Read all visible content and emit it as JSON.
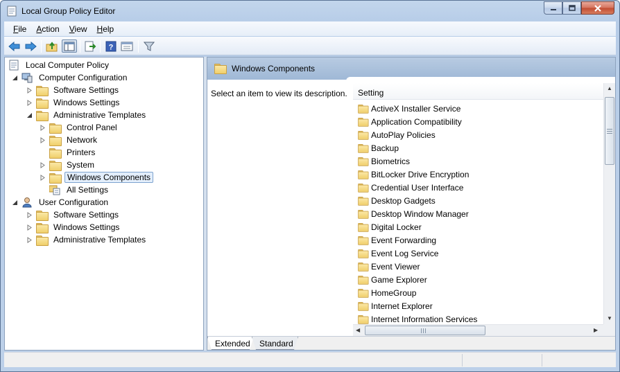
{
  "window": {
    "title": "Local Group Policy Editor"
  },
  "menu": {
    "items": [
      {
        "label": "File",
        "accel": "F",
        "rest": "ile"
      },
      {
        "label": "Action",
        "accel": "A",
        "rest": "ction"
      },
      {
        "label": "View",
        "accel": "V",
        "rest": "iew"
      },
      {
        "label": "Help",
        "accel": "H",
        "rest": "elp"
      }
    ]
  },
  "toolbar": {
    "buttons": [
      "back-icon",
      "forward-icon",
      "up-folder-icon",
      "show-hide-tree-icon",
      "export-list-icon",
      "help-icon",
      "properties-icon",
      "filter-icon"
    ]
  },
  "tree": {
    "root": "Local Computer Policy",
    "computer_configuration": "Computer Configuration",
    "cc_software_settings": "Software Settings",
    "cc_windows_settings": "Windows Settings",
    "cc_admin_templates": "Administrative Templates",
    "control_panel": "Control Panel",
    "network": "Network",
    "printers": "Printers",
    "system": "System",
    "windows_components": "Windows Components",
    "all_settings": "All Settings",
    "user_configuration": "User Configuration",
    "uc_software_settings": "Software Settings",
    "uc_windows_settings": "Windows Settings",
    "uc_admin_templates": "Administrative Templates"
  },
  "details": {
    "header_title": "Windows Components",
    "description": "Select an item to view its description.",
    "column_setting": "Setting",
    "items": [
      "ActiveX Installer Service",
      "Application Compatibility",
      "AutoPlay Policies",
      "Backup",
      "Biometrics",
      "BitLocker Drive Encryption",
      "Credential User Interface",
      "Desktop Gadgets",
      "Desktop Window Manager",
      "Digital Locker",
      "Event Forwarding",
      "Event Log Service",
      "Event Viewer",
      "Game Explorer",
      "HomeGroup",
      "Internet Explorer",
      "Internet Information Services"
    ]
  },
  "tabs": {
    "extended": "Extended",
    "standard": "Standard"
  }
}
